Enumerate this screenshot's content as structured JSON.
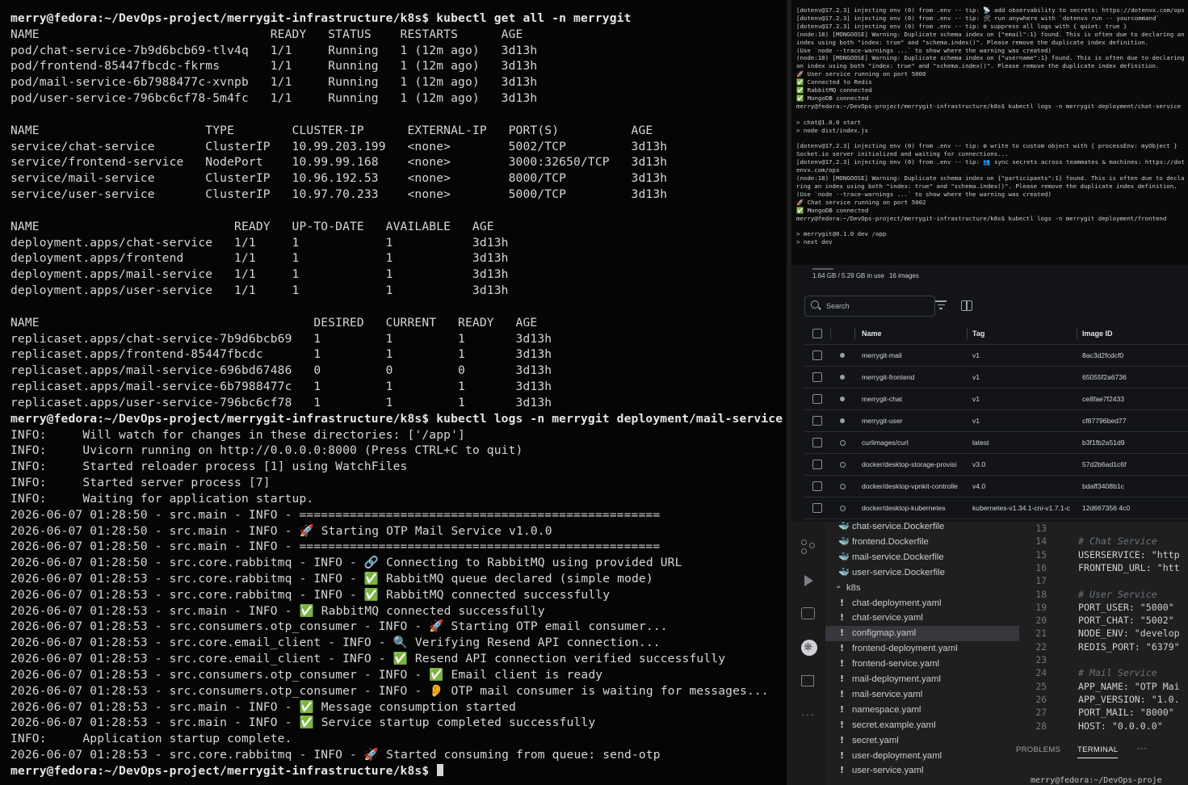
{
  "main_terminal": {
    "lines": [
      {
        "t": "merry@fedora:~/DevOps-project/merrygit-infrastructure/k8s$ kubectl get all -n merrygit",
        "p": true
      },
      {
        "t": "NAME                                READY   STATUS    RESTARTS      AGE"
      },
      {
        "t": "pod/chat-service-7b9d6bcb69-tlv4q   1/1     Running   1 (12m ago)   3d13h"
      },
      {
        "t": "pod/frontend-85447fbcdc-fkrms       1/1     Running   1 (12m ago)   3d13h"
      },
      {
        "t": "pod/mail-service-6b7988477c-xvnpb   1/1     Running   1 (12m ago)   3d13h"
      },
      {
        "t": "pod/user-service-796bc6cf78-5m4fc   1/1     Running   1 (12m ago)   3d13h"
      },
      {
        "t": ""
      },
      {
        "t": "NAME                       TYPE        CLUSTER-IP      EXTERNAL-IP   PORT(S)          AGE"
      },
      {
        "t": "service/chat-service       ClusterIP   10.99.203.199   <none>        5002/TCP         3d13h"
      },
      {
        "t": "service/frontend-service   NodePort    10.99.99.168    <none>        3000:32650/TCP   3d13h"
      },
      {
        "t": "service/mail-service       ClusterIP   10.96.192.53    <none>        8000/TCP         3d13h"
      },
      {
        "t": "service/user-service       ClusterIP   10.97.70.233    <none>        5000/TCP         3d13h"
      },
      {
        "t": ""
      },
      {
        "t": "NAME                           READY   UP-TO-DATE   AVAILABLE   AGE"
      },
      {
        "t": "deployment.apps/chat-service   1/1     1            1           3d13h"
      },
      {
        "t": "deployment.apps/frontend       1/1     1            1           3d13h"
      },
      {
        "t": "deployment.apps/mail-service   1/1     1            1           3d13h"
      },
      {
        "t": "deployment.apps/user-service   1/1     1            1           3d13h"
      },
      {
        "t": ""
      },
      {
        "t": "NAME                                      DESIRED   CURRENT   READY   AGE"
      },
      {
        "t": "replicaset.apps/chat-service-7b9d6bcb69   1         1         1       3d13h"
      },
      {
        "t": "replicaset.apps/frontend-85447fbcdc       1         1         1       3d13h"
      },
      {
        "t": "replicaset.apps/mail-service-696bd67486   0         0         0       3d13h"
      },
      {
        "t": "replicaset.apps/mail-service-6b7988477c   1         1         1       3d13h"
      },
      {
        "t": "replicaset.apps/user-service-796bc6cf78   1         1         1       3d13h"
      },
      {
        "t": "merry@fedora:~/DevOps-project/merrygit-infrastructure/k8s$ kubectl logs -n merrygit deployment/mail-service",
        "p": true
      },
      {
        "t": "INFO:     Will watch for changes in these directories: ['/app']"
      },
      {
        "t": "INFO:     Uvicorn running on http://0.0.0.0:8000 (Press CTRL+C to quit)"
      },
      {
        "t": "INFO:     Started reloader process [1] using WatchFiles"
      },
      {
        "t": "INFO:     Started server process [7]"
      },
      {
        "t": "INFO:     Waiting for application startup."
      },
      {
        "t": "2026-06-07 01:28:50 - src.main - INFO - =================================================="
      },
      {
        "t": "2026-06-07 01:28:50 - src.main - INFO - 🚀 Starting OTP Mail Service v1.0.0"
      },
      {
        "t": "2026-06-07 01:28:50 - src.main - INFO - =================================================="
      },
      {
        "t": "2026-06-07 01:28:50 - src.core.rabbitmq - INFO - 🔗 Connecting to RabbitMQ using provided URL"
      },
      {
        "t": "2026-06-07 01:28:53 - src.core.rabbitmq - INFO - ✅ RabbitMQ queue declared (simple mode)"
      },
      {
        "t": "2026-06-07 01:28:53 - src.core.rabbitmq - INFO - ✅ RabbitMQ connected successfully"
      },
      {
        "t": "2026-06-07 01:28:53 - src.main - INFO - ✅ RabbitMQ connected successfully"
      },
      {
        "t": "2026-06-07 01:28:53 - src.consumers.otp_consumer - INFO - 🚀 Starting OTP email consumer..."
      },
      {
        "t": "2026-06-07 01:28:53 - src.core.email_client - INFO - 🔍 Verifying Resend API connection..."
      },
      {
        "t": "2026-06-07 01:28:53 - src.core.email_client - INFO - ✅ Resend API connection verified successfully"
      },
      {
        "t": "2026-06-07 01:28:53 - src.consumers.otp_consumer - INFO - ✅ Email client is ready"
      },
      {
        "t": "2026-06-07 01:28:53 - src.consumers.otp_consumer - INFO - 👂 OTP mail consumer is waiting for messages..."
      },
      {
        "t": "2026-06-07 01:28:53 - src.main - INFO - ✅ Message consumption started"
      },
      {
        "t": "2026-06-07 01:28:53 - src.main - INFO - ✅ Service startup completed successfully"
      },
      {
        "t": "INFO:     Application startup complete."
      },
      {
        "t": "2026-06-07 01:28:53 - src.core.rabbitmq - INFO - 🚀 Started consuming from queue: send-otp"
      },
      {
        "t": "merry@fedora:~/DevOps-project/merrygit-infrastructure/k8s$ ",
        "p": true,
        "cursor": true
      }
    ]
  },
  "small_terminal": {
    "lines": [
      "[dotenv@17.2.3] injecting env (0) from .env -- tip: 📡 add observability to secrets: https://dotenvx.com/ops",
      "[dotenv@17.2.3] injecting env (0) from .env -- tip: 🛠 run anywhere with `dotenvx run -- yourcommand`",
      "[dotenv@17.2.3] injecting env (0) from .env -- tip: ⚙ suppress all logs with { quiet: true }",
      "(node:18) [MONGOOSE] Warning: Duplicate schema index on {\"email\":1} found. This is often due to declaring an index using both \"index: true\" and \"schema.index()\". Please remove the duplicate index definition.",
      "(Use `node --trace-warnings ...` to show where the warning was created)",
      "(node:18) [MONGOOSE] Warning: Duplicate schema index on {\"username\":1} found. This is often due to declaring an index using both \"index: true\" and \"schema.index()\". Please remove the duplicate index definition.",
      "🚀 User service running on port 5000",
      "✅ Connected to Redis",
      "✅ RabbitMQ connected",
      "✅ MongoDB connected",
      "merry@fedora:~/DevOps-project/merrygit-infrastructure/k8s$ kubectl logs -n merrygit deployment/chat-service",
      "",
      "> chat@1.0.0 start",
      "> node dist/index.js",
      "",
      "[dotenv@17.2.3] injecting env (0) from .env -- tip: ⚙ write to custom object with { processEnv: myObject }",
      "Socket.io server initialized and waiting for connections...",
      "[dotenv@17.2.3] injecting env (0) from .env -- tip: 👥 sync secrets across teammates & machines: https://dotenvx.com/ops",
      "(node:18) [MONGOOSE] Warning: Duplicate schema index on {\"participants\":1} found. This is often due to declaring an index using both \"index: true\" and \"schema.index()\". Please remove the duplicate index definition.",
      "(Use `node --trace-warnings ...` to show where the warning was created)",
      "🚀 Chat service running on port 5002",
      "✅ MongoDB connected",
      "merry@fedora:~/DevOps-project/merrygit-infrastructure/k8s$ kubectl logs -n merrygit deployment/frontend",
      "",
      "> merrygit@0.1.0 dev /app",
      "> next dev"
    ]
  },
  "docker": {
    "storage": "1.64 GB / 5.29 GB in use",
    "image_count": "16 images",
    "search_placeholder": "Search",
    "columns": {
      "name": "Name",
      "tag": "Tag",
      "id": "Image ID"
    },
    "images": [
      {
        "name": "merrygit-mail",
        "tag": "v1",
        "id": "8ac3d2fcdcf0",
        "used": true
      },
      {
        "name": "merrygit-frontend",
        "tag": "v1",
        "id": "65055f2a6736",
        "used": true
      },
      {
        "name": "merrygit-chat",
        "tag": "v1",
        "id": "ce8fae7f2433",
        "used": true
      },
      {
        "name": "merrygit-user",
        "tag": "v1",
        "id": "cf87796bed77",
        "used": true
      },
      {
        "name": "curlimages/curl",
        "tag": "latest",
        "id": "b3f1fb2a51d9",
        "used": false
      },
      {
        "name": "docker/desktop-storage-provisi",
        "tag": "v3.0",
        "id": "57d2b6ad1c6f",
        "used": false
      },
      {
        "name": "docker/desktop-vpnkit-controlle",
        "tag": "v4.0",
        "id": "bdaff3408b1c",
        "used": false
      },
      {
        "name": "docker/desktop-kubernetes",
        "tag": "kubernetes-v1.34.1-cni-v1.7.1-c",
        "id": "12d667356 4c0",
        "used": false
      }
    ]
  },
  "vscode": {
    "files": [
      {
        "name": "chat-service.Dockerfile",
        "kind": "docker",
        "depth": 1
      },
      {
        "name": "frontend.Dockerfile",
        "kind": "docker",
        "depth": 1
      },
      {
        "name": "mail-service.Dockerfile",
        "kind": "docker",
        "depth": 1
      },
      {
        "name": "user-service.Dockerfile",
        "kind": "docker",
        "depth": 1
      },
      {
        "name": "k8s",
        "kind": "folder",
        "depth": 0
      },
      {
        "name": "chat-deployment.yaml",
        "kind": "yaml",
        "depth": 1
      },
      {
        "name": "chat-service.yaml",
        "kind": "yaml",
        "depth": 1
      },
      {
        "name": "configmap.yaml",
        "kind": "yaml",
        "depth": 1,
        "selected": true
      },
      {
        "name": "frontend-deployment.yaml",
        "kind": "yaml",
        "depth": 1
      },
      {
        "name": "frontend-service.yaml",
        "kind": "yaml",
        "depth": 1
      },
      {
        "name": "mail-deployment.yaml",
        "kind": "yaml",
        "depth": 1
      },
      {
        "name": "mail-service.yaml",
        "kind": "yaml",
        "depth": 1
      },
      {
        "name": "namespace.yaml",
        "kind": "yaml",
        "depth": 1
      },
      {
        "name": "secret.example.yaml",
        "kind": "yaml",
        "depth": 1
      },
      {
        "name": "secret.yaml",
        "kind": "yaml",
        "depth": 1
      },
      {
        "name": "user-deployment.yaml",
        "kind": "yaml",
        "depth": 1
      },
      {
        "name": "user-service.yaml",
        "kind": "yaml",
        "depth": 1
      }
    ],
    "line_numbers": [
      "13",
      "14",
      "15",
      "16",
      "17",
      "18",
      "19",
      "20",
      "21",
      "22",
      "23",
      "24",
      "25",
      "26",
      "27",
      "28"
    ],
    "code": [
      {
        "t": "",
        "c": false
      },
      {
        "t": "# Chat Service",
        "c": true
      },
      {
        "t": "USERSERVICE: \"http",
        "c": false
      },
      {
        "t": "FRONTEND_URL: \"htt",
        "c": false
      },
      {
        "t": "",
        "c": false
      },
      {
        "t": "# User Service",
        "c": true
      },
      {
        "t": "PORT_USER: \"5000\"",
        "c": false
      },
      {
        "t": "PORT_CHAT: \"5002\"",
        "c": false
      },
      {
        "t": "NODE_ENV: \"develop",
        "c": false
      },
      {
        "t": "REDIS_PORT: \"6379\"",
        "c": false
      },
      {
        "t": "",
        "c": false
      },
      {
        "t": "# Mail Service",
        "c": true
      },
      {
        "t": "APP_NAME: \"OTP Mai",
        "c": false
      },
      {
        "t": "APP_VERSION: \"1.0.",
        "c": false
      },
      {
        "t": "PORT_MAIL: \"8000\"",
        "c": false
      },
      {
        "t": "HOST: \"0.0.0.0\"",
        "c": false
      }
    ],
    "panel_tabs": {
      "problems": "PROBLEMS",
      "terminal": "TERMINAL",
      "more": "···"
    },
    "panel_terminal_text": "merry@fedora:~/DevOps-proje"
  }
}
